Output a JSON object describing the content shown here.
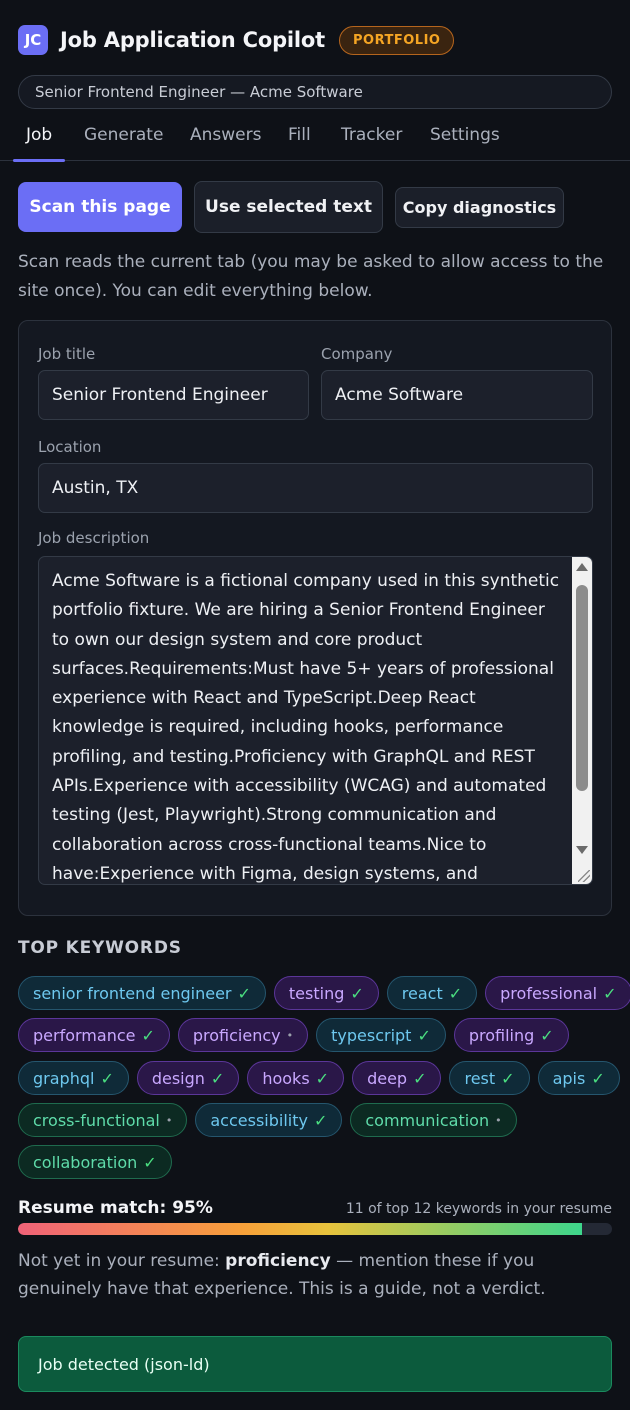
{
  "header": {
    "logo": "JC",
    "title": "Job Application Copilot",
    "badge": "PORTFOLIO"
  },
  "job_selector": "Senior Frontend Engineer — Acme Software",
  "tabs": [
    "Job",
    "Generate",
    "Answers",
    "Fill",
    "Tracker",
    "Settings"
  ],
  "active_tab": "Job",
  "actions": {
    "scan": "Scan this page",
    "use_selected": "Use selected text",
    "copy_diagnostics": "Copy diagnostics"
  },
  "hint": "Scan reads the current tab (you may be asked to allow access to the site once). You can edit everything below.",
  "form": {
    "job_title_label": "Job title",
    "job_title_value": "Senior Frontend Engineer",
    "company_label": "Company",
    "company_value": "Acme Software",
    "location_label": "Location",
    "location_value": "Austin, TX",
    "description_label": "Job description",
    "description_value": "Acme Software is a fictional company used in this synthetic portfolio fixture. We are hiring a Senior Frontend Engineer to own our design system and core product surfaces.Requirements:Must have 5+ years of professional experience with React and TypeScript.Deep React knowledge is required, including hooks, performance profiling, and testing.Proficiency with GraphQL and REST APIs.Experience with accessibility (WCAG) and automated testing (Jest, Playwright).Strong communication and collaboration across cross-functional teams.Nice to have:Experience with Figma, design systems, and"
  },
  "keywords": {
    "title": "TOP KEYWORDS",
    "matched_mark": "✓",
    "missing_mark": "•",
    "rows": [
      [
        {
          "text": "senior frontend engineer",
          "color": "blue",
          "matched": true
        },
        {
          "text": "testing",
          "color": "purple",
          "matched": true
        },
        {
          "text": "react",
          "color": "blue",
          "matched": true
        },
        {
          "text": "professional",
          "color": "purple",
          "matched": true
        }
      ],
      [
        {
          "text": "performance",
          "color": "purple",
          "matched": true
        },
        {
          "text": "proficiency",
          "color": "purple",
          "matched": false
        },
        {
          "text": "typescript",
          "color": "blue",
          "matched": true
        },
        {
          "text": "profiling",
          "color": "purple",
          "matched": true
        }
      ],
      [
        {
          "text": "graphql",
          "color": "blue",
          "matched": true
        },
        {
          "text": "design",
          "color": "purple",
          "matched": true
        },
        {
          "text": "hooks",
          "color": "purple",
          "matched": true
        },
        {
          "text": "deep",
          "color": "purple",
          "matched": true
        },
        {
          "text": "rest",
          "color": "blue",
          "matched": true
        },
        {
          "text": "apis",
          "color": "blue",
          "matched": true
        }
      ],
      [
        {
          "text": "cross-functional",
          "color": "green",
          "matched": false
        },
        {
          "text": "accessibility",
          "color": "blue",
          "matched": true
        },
        {
          "text": "communication",
          "color": "green",
          "matched": false
        }
      ],
      [
        {
          "text": "collaboration",
          "color": "green",
          "matched": true
        }
      ]
    ]
  },
  "match": {
    "label": "Resume match: 95%",
    "percent": 95,
    "note": "11 of top 12 keywords in your resume",
    "missing_prefix": "Not yet in your resume: ",
    "missing_terms": "proficiency",
    "missing_suffix": " — mention these if you genuinely have that experience. This is a guide, not a verdict."
  },
  "status": "Job detected (json-ld)",
  "colors": {
    "accent": "#6b6ef5",
    "badge": "#f5a524",
    "status_bg": "#0c5b3d",
    "matched_check": "#4ade80"
  }
}
